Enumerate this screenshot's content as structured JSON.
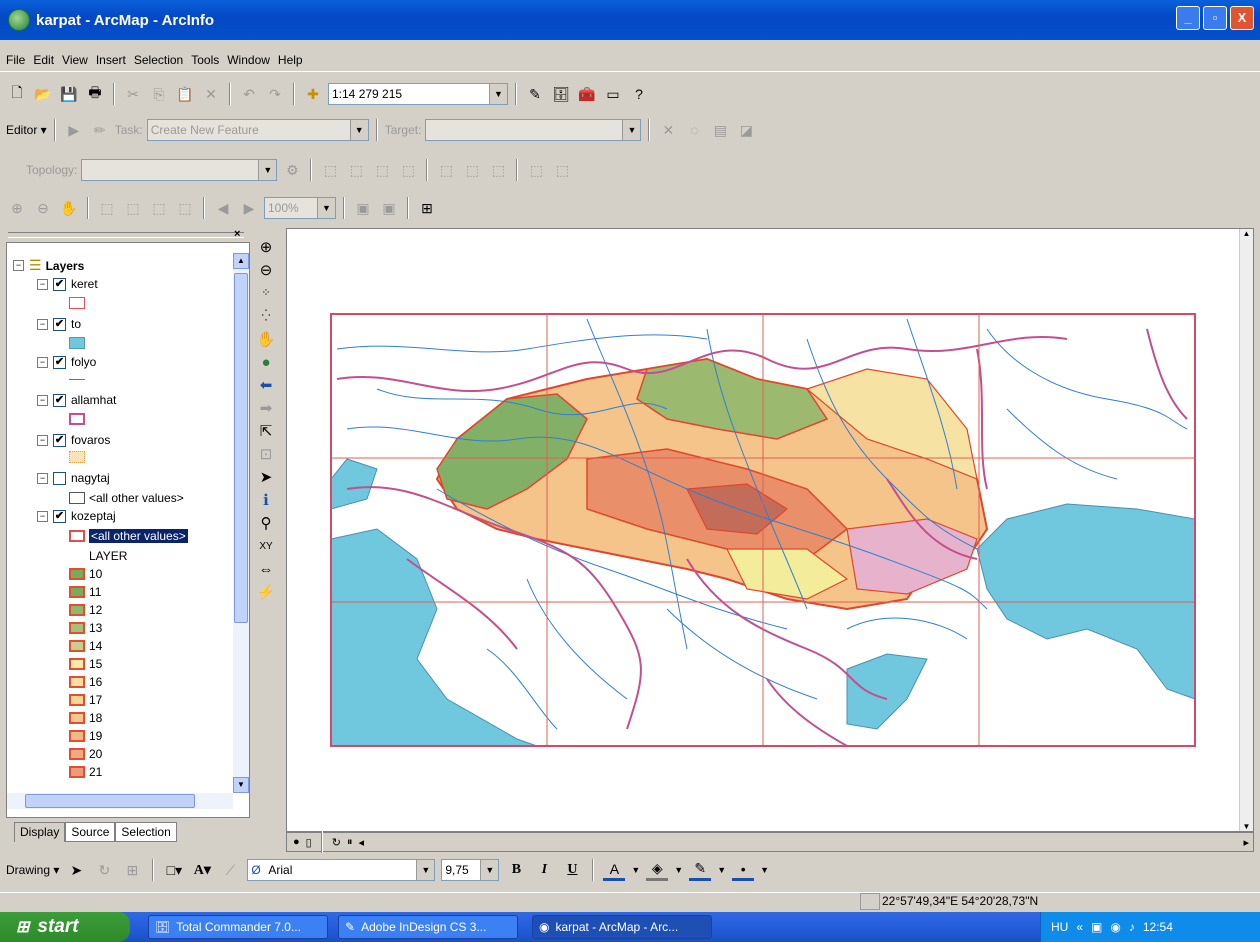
{
  "window": {
    "title": "karpat - ArcMap - ArcInfo",
    "min": "_",
    "max": "▫",
    "close": "X"
  },
  "menu": [
    "File",
    "Edit",
    "View",
    "Insert",
    "Selection",
    "Tools",
    "Window",
    "Help"
  ],
  "standard": {
    "scale": "1:14 279 215"
  },
  "editor": {
    "label": "Editor ▾",
    "task_label": "Task:",
    "task_value": "Create New Feature",
    "target_label": "Target:"
  },
  "topology": {
    "label": "Topology:"
  },
  "layout": {
    "zoom": "100%"
  },
  "toc": {
    "root": "Layers",
    "layers": [
      {
        "name": "keret",
        "checked": "✔"
      },
      {
        "name": "to",
        "checked": "✔"
      },
      {
        "name": "folyo",
        "checked": "✔"
      },
      {
        "name": "allamhat",
        "checked": "✔"
      },
      {
        "name": "fovaros",
        "checked": "✔"
      },
      {
        "name": "nagytaj",
        "checked": ""
      },
      {
        "name": "kozeptaj",
        "checked": "✔"
      }
    ],
    "other_values": "<all other values>",
    "field": "LAYER",
    "classes": [
      "10",
      "11",
      "12",
      "13",
      "14",
      "15",
      "16",
      "17",
      "18",
      "19",
      "20",
      "21"
    ],
    "tabs": [
      "Display",
      "Source",
      "Selection"
    ]
  },
  "drawing": {
    "label": "Drawing ▾",
    "font": "Arial",
    "size": "9,75",
    "bold": "B",
    "italic": "I",
    "underline": "U"
  },
  "status": {
    "coords": "22°57'49,34\"E  54°20'28,73\"N"
  },
  "taskbar": {
    "start": "start",
    "items": [
      "Total Commander 7.0...",
      "Adobe InDesign CS 3...",
      "karpat - ArcMap - Arc..."
    ],
    "lang": "HU",
    "clock": "12:54"
  },
  "colors": {
    "sea": "#6fc8de",
    "border": "#c2508f",
    "river": "#2f7fd3",
    "frame": "#d14a6a",
    "grid": "#e06050"
  }
}
